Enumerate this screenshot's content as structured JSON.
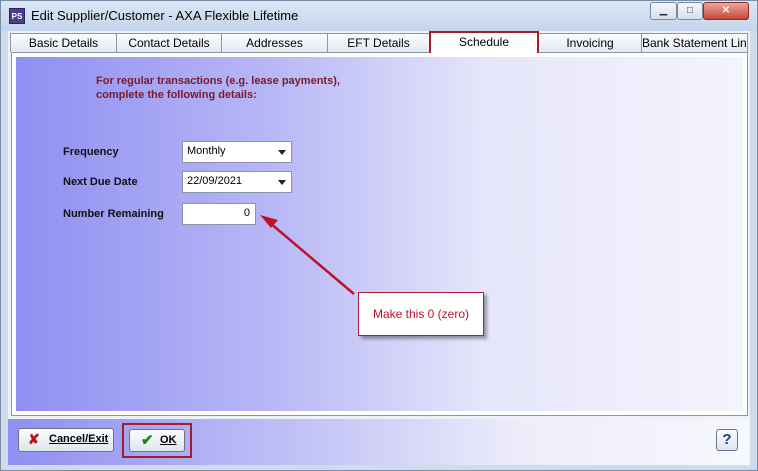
{
  "window": {
    "title": "Edit Supplier/Customer - AXA Flexible Lifetime",
    "app_icon_text": "PS",
    "min_glyph": "▁",
    "max_glyph": "□",
    "close_glyph": "✕"
  },
  "tabs": [
    {
      "label": "Basic Details",
      "active": false
    },
    {
      "label": "Contact Details",
      "active": false
    },
    {
      "label": "Addresses",
      "active": false
    },
    {
      "label": "EFT Details",
      "active": false
    },
    {
      "label": "Schedule",
      "active": true
    },
    {
      "label": "Invoicing",
      "active": false
    },
    {
      "label": "Bank Statement Link",
      "active": false
    }
  ],
  "schedule": {
    "intro_text": "For regular transactions (e.g. lease payments), complete the following details:",
    "frequency_label": "Frequency",
    "frequency_value": "Monthly",
    "next_due_label": "Next Due Date",
    "next_due_value": "22/09/2021",
    "number_remaining_label": "Number Remaining",
    "number_remaining_value": "0"
  },
  "annotation": {
    "callout_text": "Make this 0 (zero)",
    "color": "#c0102a"
  },
  "footer": {
    "cancel_label": "Cancel/Exit",
    "cancel_icon": "✘",
    "ok_label": "OK",
    "ok_icon": "✔",
    "help_label": "?"
  }
}
